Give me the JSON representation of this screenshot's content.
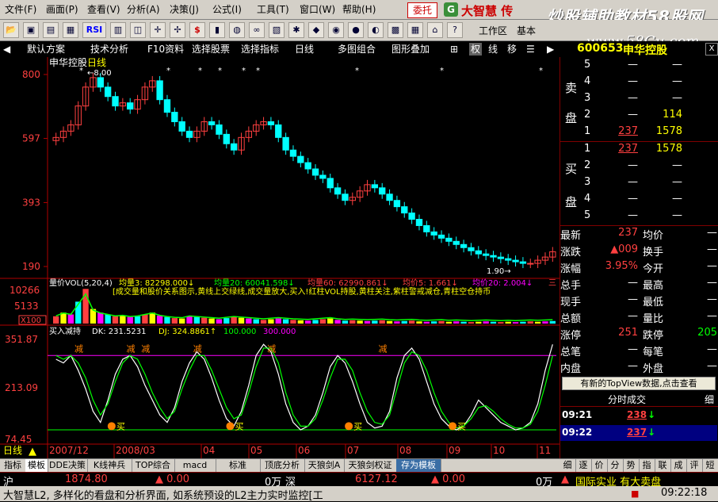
{
  "menu": {
    "items": [
      "文件(F)",
      "画面(P)",
      "查看(V)",
      "分析(A)",
      "决策(J)",
      "公式(I)",
      "工具(T)",
      "窗口(W)",
      "帮助(H)"
    ],
    "trust_label": "委托",
    "logo_letter": "G",
    "brand": "大智慧 传"
  },
  "watermark": {
    "line1": "炒股辅助教材58股网",
    "line2": "www.58Gu.com"
  },
  "toolbar": {
    "icons": [
      "open-icon",
      "save-icon",
      "chart-icon",
      "grid-icon",
      "rsi-icon",
      "table-icon",
      "diagram-icon",
      "cross-icon",
      "pattern-icon",
      "money-icon",
      "bars-icon",
      "gauge-icon",
      "binoculars-icon",
      "page-icon",
      "bell-icon",
      "diamond-icon",
      "flag-icon",
      "globe-icon",
      "ball-icon",
      "report-icon",
      "calc-icon",
      "house-icon",
      "help-icon"
    ],
    "rsi_label": "RSI",
    "money_label": "$",
    "workspace_label": "工作区",
    "basic_label": "基本"
  },
  "nav": {
    "items": [
      "默认方案",
      "技术分析",
      "F10资料",
      "选择股票",
      "选择指标",
      "日线",
      "多图组合",
      "图形叠加"
    ],
    "icon_buttons": [
      "⊞",
      "权",
      "线",
      "移",
      "☰"
    ],
    "active_index": 1
  },
  "stock": {
    "code": "600653",
    "name": "申华控股",
    "close_icon": "X"
  },
  "kline": {
    "title": "申华控股",
    "period": "日线",
    "y_ticks": [
      "800",
      "597",
      "393",
      "190"
    ],
    "high_label": "8.00",
    "low_label": "1.90"
  },
  "volume": {
    "header": "量价VOL(5,20,4)",
    "ma3_label": "均量3: 82298.000↓",
    "ma20_label": "均量20: 60041.598↓",
    "ma60_label": "均量60: 62990.861↓",
    "ma5_label": "均价5: 1.661↓",
    "ma20p_label": "均价20: 2.004↓",
    "red_tail": "三",
    "desc": "[成交量和股价关系图示,黄线上交绿线,成交量放大,买入!红柱VOL持股,黄柱关注,紫柱警戒减仓,青柱空仓持币",
    "y_ticks": [
      "10266",
      "5133",
      "X100"
    ]
  },
  "indicator": {
    "header": "买入减持",
    "dk_label": "DK: 231.5231",
    "dj_label": "DJ: 324.8861",
    "line1_label": "100.000",
    "line2_label": "300.000",
    "y_ticks": [
      "351.87",
      "213.09",
      "74.45"
    ],
    "buy_label": "买",
    "sell_label": "减",
    "x_dates": [
      "2007/12",
      "2008/03",
      "04",
      "05",
      "06",
      "07",
      "08",
      "09",
      "10",
      "11"
    ]
  },
  "orderbook": {
    "sell_label_top": "卖",
    "sell_label_bottom": "盘",
    "buy_label_top": "买",
    "buy_label_bottom": "盘",
    "sell": [
      {
        "level": "5",
        "price": "—",
        "vol": "—"
      },
      {
        "level": "4",
        "price": "—",
        "vol": "—"
      },
      {
        "level": "3",
        "price": "—",
        "vol": "—"
      },
      {
        "level": "2",
        "price": "—",
        "vol": "114"
      },
      {
        "level": "1",
        "price": "237",
        "vol": "1578"
      }
    ],
    "buy": [
      {
        "level": "1",
        "price": "237",
        "vol": "1578"
      },
      {
        "level": "2",
        "price": "—",
        "vol": "—"
      },
      {
        "level": "3",
        "price": "—",
        "vol": "—"
      },
      {
        "level": "4",
        "price": "—",
        "vol": "—"
      },
      {
        "level": "5",
        "price": "—",
        "vol": "—"
      }
    ]
  },
  "quote": [
    {
      "k1": "最新",
      "v1": "237",
      "c1": "#ff4040",
      "k2": "均价",
      "v2": "—",
      "c2": "#ffffff"
    },
    {
      "k1": "涨跌",
      "v1": "▲009",
      "c1": "#ff4040",
      "k2": "换手",
      "v2": "—",
      "c2": "#ffffff"
    },
    {
      "k1": "涨幅",
      "v1": "3.95%",
      "c1": "#ff4040",
      "k2": "今开",
      "v2": "—",
      "c2": "#ffffff"
    },
    {
      "k1": "总手",
      "v1": "—",
      "c1": "#ffffff",
      "k2": "最高",
      "v2": "—",
      "c2": "#ffffff"
    },
    {
      "k1": "现手",
      "v1": "—",
      "c1": "#ffffff",
      "k2": "最低",
      "v2": "—",
      "c2": "#ffffff"
    },
    {
      "k1": "总额",
      "v1": "—",
      "c1": "#ffffff",
      "k2": "量比",
      "v2": "—",
      "c2": "#ffffff"
    },
    {
      "k1": "涨停",
      "v1": "251",
      "c1": "#ff4040",
      "k2": "跌停",
      "v2": "205",
      "c2": "#00ff00"
    },
    {
      "k1": "总笔",
      "v1": "—",
      "c1": "#ffffff",
      "k2": "每笔",
      "v2": "—",
      "c2": "#ffffff"
    },
    {
      "k1": "内盘",
      "v1": "—",
      "c1": "#ffffff",
      "k2": "外盘",
      "v2": "—",
      "c2": "#ffffff"
    }
  ],
  "topview_label": "有新的TopView数据,点击查看",
  "fenshi": {
    "title": "分时成交",
    "detail": "细",
    "rows": [
      {
        "time": "09:21",
        "price": "238",
        "arrow": "↓"
      },
      {
        "time": "09:22",
        "price": "237",
        "arrow": "↓"
      }
    ]
  },
  "bottom_tabs": {
    "left": [
      "指标",
      "模板",
      "DDE决策",
      "K线神兵",
      "TOP综合",
      "macd",
      "标准",
      "顶底分析",
      "天狼剑A",
      "天狼剑权证",
      "存为模板"
    ],
    "right": [
      "细",
      "逐",
      "价",
      "分",
      "势",
      "指",
      "联",
      "成",
      "评",
      "短"
    ]
  },
  "status1": {
    "market": "沪",
    "price": "1874.80",
    "change": "▲ 0.00",
    "amount": "0万",
    "market2": "深",
    "price2": "6127.12",
    "change2": "▲ 0.00",
    "amount2": "0万",
    "ticker": "国际实业 有大卖盘"
  },
  "status2": {
    "scroll_text": "大智慧L2, 多样化的看盘和分析界面, 如系统预设的L2主力实时监控[工",
    "time": "09:22:18"
  },
  "chart_data": [
    {
      "type": "candlestick",
      "title": "申华控股",
      "ylabel": "",
      "yticks": [
        800,
        597,
        393,
        190
      ],
      "ylim": [
        170,
        820
      ],
      "x_dates": [
        "2007/12",
        "2008/03",
        "04",
        "05",
        "06",
        "07",
        "08",
        "09",
        "10",
        "11"
      ],
      "close": [
        600,
        620,
        640,
        700,
        760,
        790,
        760,
        730,
        700,
        710,
        690,
        720,
        760,
        780,
        720,
        680,
        650,
        620,
        600,
        620,
        650,
        640,
        610,
        580,
        560,
        600,
        620,
        640,
        650,
        640,
        600,
        560,
        540,
        520,
        500,
        480,
        470,
        440,
        420,
        400,
        410,
        430,
        450,
        440,
        420,
        400,
        380,
        360,
        340,
        320,
        300,
        290,
        280,
        270,
        260,
        250,
        240,
        230,
        225,
        220,
        215,
        210,
        205,
        200,
        200,
        210,
        220,
        237
      ]
    },
    {
      "type": "bar",
      "title": "量价VOL(5,20,4)",
      "yticks": [
        10266,
        5133
      ],
      "values": [
        20,
        30,
        25,
        60,
        95,
        40,
        30,
        25,
        20,
        22,
        18,
        20,
        25,
        30,
        22,
        18,
        15,
        14,
        20,
        18,
        16,
        14,
        12,
        15,
        18,
        16,
        14,
        12,
        10,
        12,
        14,
        12,
        10,
        9,
        8,
        10,
        12,
        14,
        10,
        8,
        9,
        8,
        7,
        8,
        9,
        7,
        6,
        7,
        8,
        6,
        5,
        6,
        7,
        5,
        6,
        5,
        4,
        5,
        6,
        5,
        4,
        5,
        4,
        5,
        6,
        5,
        6,
        7
      ]
    },
    {
      "type": "line",
      "title": "买入减持",
      "yticks": [
        351.87,
        213.09,
        74.45
      ],
      "ylim": [
        74.45,
        351.87
      ],
      "series": [
        {
          "name": "DK",
          "values": [
            290,
            280,
            300,
            260,
            210,
            150,
            120,
            180,
            250,
            290,
            300,
            270,
            220,
            180,
            140,
            120,
            160,
            230,
            280,
            310,
            290,
            240,
            180,
            130,
            110,
            150,
            220,
            300,
            330,
            310,
            250,
            170,
            120,
            100,
            110,
            140,
            200,
            270,
            300,
            280,
            230,
            170,
            120,
            105,
            110,
            150,
            240,
            300,
            320,
            290,
            230,
            170,
            130,
            110,
            100,
            110,
            140,
            180,
            160,
            140,
            120,
            110,
            100,
            105,
            120,
            170,
            260,
            330
          ]
        },
        {
          "name": "DJ",
          "values": [
            300,
            290,
            300,
            280,
            240,
            180,
            140,
            170,
            230,
            280,
            300,
            290,
            250,
            200,
            160,
            130,
            150,
            210,
            260,
            300,
            300,
            260,
            210,
            160,
            130,
            140,
            200,
            270,
            320,
            320,
            280,
            200,
            140,
            110,
            110,
            130,
            180,
            240,
            290,
            290,
            260,
            200,
            150,
            120,
            115,
            140,
            210,
            280,
            310,
            300,
            260,
            200,
            150,
            120,
            105,
            110,
            130,
            160,
            165,
            150,
            130,
            115,
            105,
            105,
            115,
            150,
            220,
            300
          ]
        }
      ]
    }
  ]
}
